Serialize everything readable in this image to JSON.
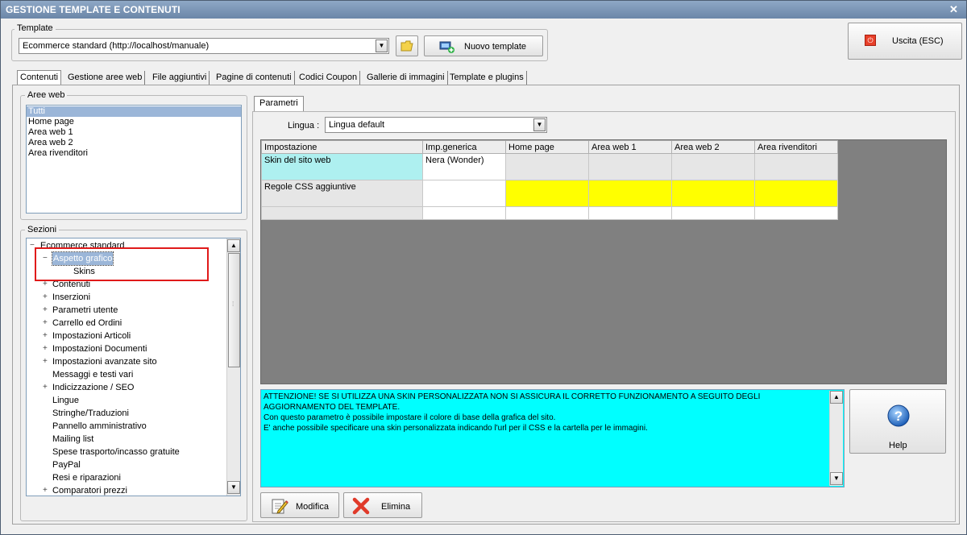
{
  "window": {
    "title": "GESTIONE TEMPLATE E CONTENUTI",
    "close_glyph": "✕"
  },
  "template": {
    "label": "Template",
    "selected": "Ecommerce standard (http://localhost/manuale)",
    "new_button": "Nuovo template",
    "exit_button": "Uscita (ESC)"
  },
  "tabs": [
    {
      "label": "Contenuti",
      "active": true
    },
    {
      "label": "Gestione aree web"
    },
    {
      "label": "File aggiuntivi"
    },
    {
      "label": "Pagine di contenuti"
    },
    {
      "label": "Codici Coupon"
    },
    {
      "label": "Gallerie di immagini"
    },
    {
      "label": "Template e plugins"
    }
  ],
  "aree_web": {
    "label": "Aree web",
    "items": [
      "Tutti",
      "Home page",
      "Area web 1",
      "Area web 2",
      "Area rivenditori"
    ],
    "selected_index": 0
  },
  "sezioni": {
    "label": "Sezioni",
    "root": "Ecommerce standard",
    "items": [
      {
        "label": "Aspetto grafico",
        "expander": "−",
        "level": 1,
        "selected": true
      },
      {
        "label": "Skins",
        "expander": "",
        "level": 2
      },
      {
        "label": "Contenuti",
        "expander": "+",
        "level": 1
      },
      {
        "label": "Inserzioni",
        "expander": "+",
        "level": 1
      },
      {
        "label": "Parametri utente",
        "expander": "+",
        "level": 1
      },
      {
        "label": "Carrello ed Ordini",
        "expander": "+",
        "level": 1
      },
      {
        "label": "Impostazioni Articoli",
        "expander": "+",
        "level": 1
      },
      {
        "label": "Impostazioni Documenti",
        "expander": "+",
        "level": 1
      },
      {
        "label": "Impostazioni avanzate sito",
        "expander": "+",
        "level": 1
      },
      {
        "label": "Messaggi e testi vari",
        "expander": "",
        "level": 1
      },
      {
        "label": "Indicizzazione / SEO",
        "expander": "+",
        "level": 1
      },
      {
        "label": "Lingue",
        "expander": "",
        "level": 1
      },
      {
        "label": "Stringhe/Traduzioni",
        "expander": "",
        "level": 1
      },
      {
        "label": "Pannello amministrativo",
        "expander": "",
        "level": 1
      },
      {
        "label": "Mailing list",
        "expander": "",
        "level": 1
      },
      {
        "label": "Spese trasporto/incasso gratuite",
        "expander": "",
        "level": 1
      },
      {
        "label": "PayPal",
        "expander": "",
        "level": 1
      },
      {
        "label": "Resi e riparazioni",
        "expander": "",
        "level": 1
      },
      {
        "label": "Comparatori prezzi",
        "expander": "+",
        "level": 1
      }
    ]
  },
  "parametri": {
    "tab_label": "Parametri",
    "lingua_label": "Lingua :",
    "lingua_value": "Lingua default",
    "columns": [
      "Impostazione",
      "Imp.generica",
      "Home page",
      "Area web 1",
      "Area web 2",
      "Area rivenditori"
    ],
    "rows": [
      {
        "cells": [
          "Skin del sito web",
          "Nera (Wonder)",
          "",
          "",
          "",
          ""
        ],
        "style": "skin"
      },
      {
        "cells": [
          "Regole CSS aggiuntive",
          "",
          "",
          "",
          "",
          ""
        ],
        "style": "css"
      },
      {
        "cells": [
          "",
          "",
          "",
          "",
          "",
          ""
        ],
        "style": "empty"
      }
    ]
  },
  "info": {
    "line1": "ATTENZIONE! SE SI UTILIZZA UNA SKIN PERSONALIZZATA NON SI ASSICURA IL CORRETTO FUNZIONAMENTO A SEGUITO DEGLI",
    "line2": "AGGIORNAMENTO DEL TEMPLATE.",
    "line3": "Con questo parametro è possibile impostare il colore di base della grafica del sito.",
    "line4": "E' anche possibile specificare una skin personalizzata indicando l'url per il CSS e la cartella per le immagini."
  },
  "buttons": {
    "help": "Help",
    "modifica": "Modifica",
    "elimina": "Elimina"
  },
  "colors": {
    "cyan": "#00ffff",
    "skin_cell": "#aef0f0",
    "css_cell": "#ffff00",
    "grid_bg": "#808080",
    "highlight": "#e01a1a"
  }
}
